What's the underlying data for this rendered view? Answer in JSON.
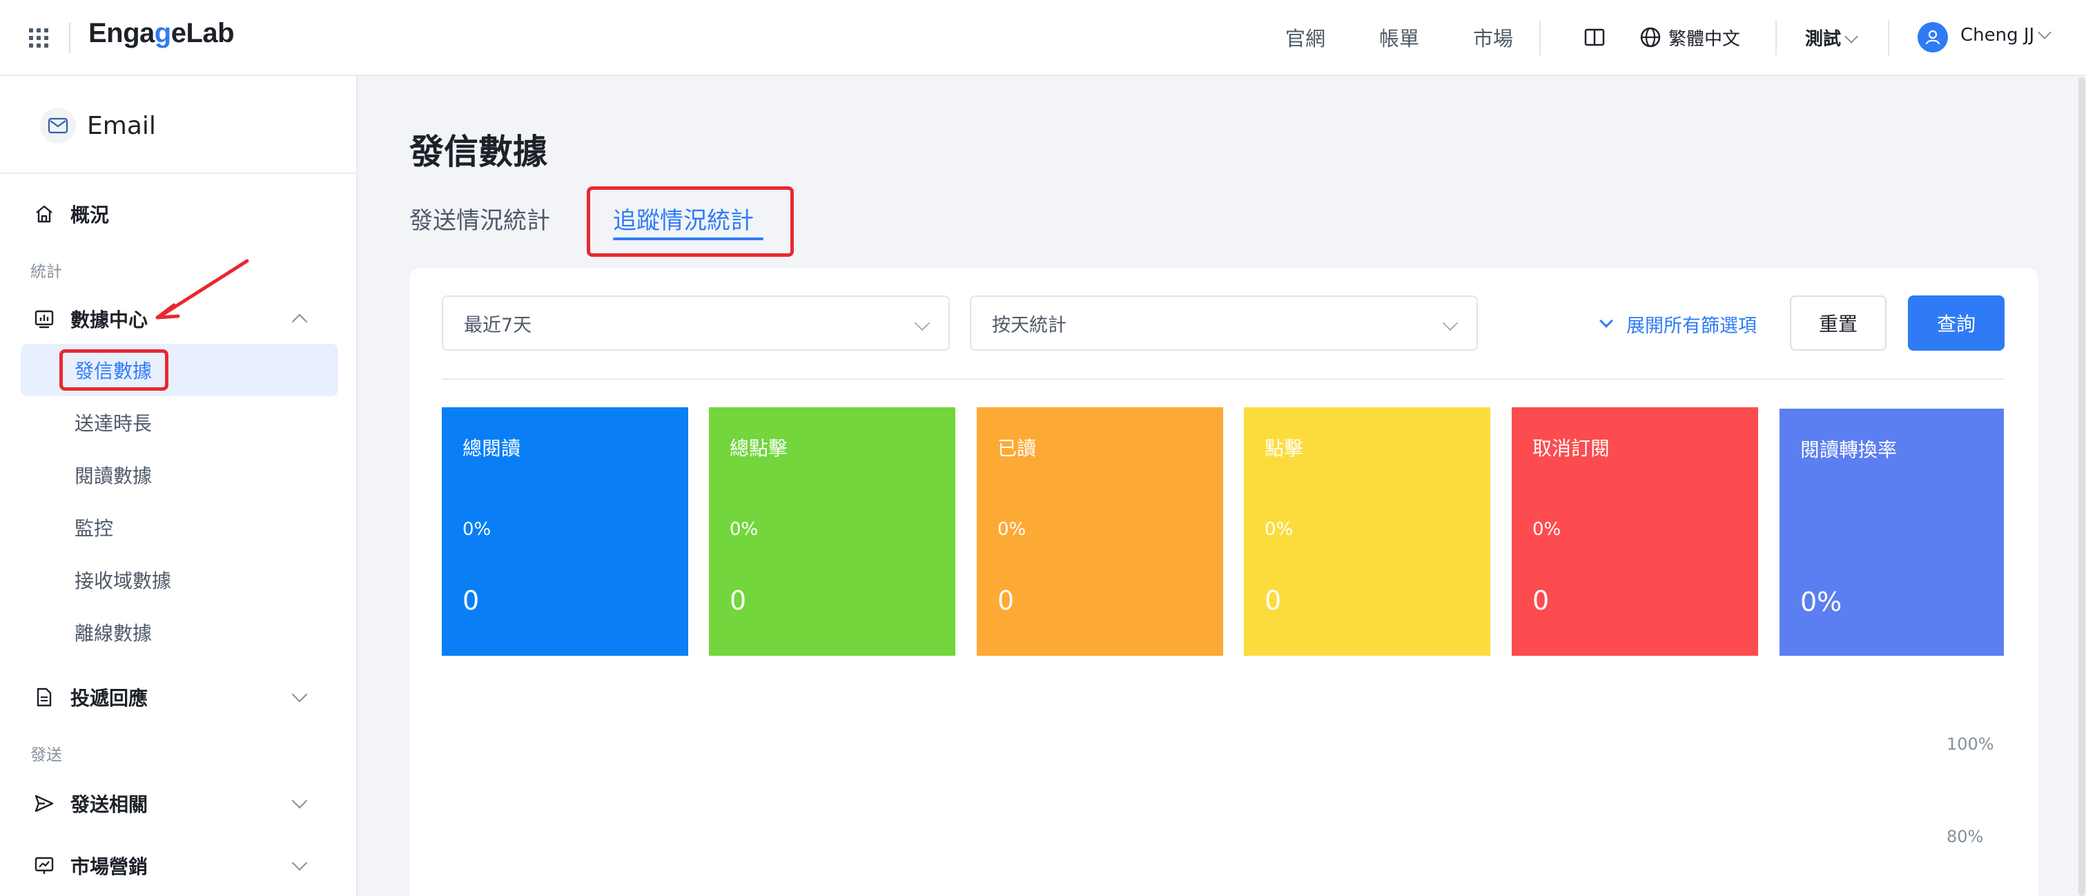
{
  "header": {
    "logo_pre": "Enga",
    "logo_accent": "g",
    "logo_post": "eLab",
    "nav": [
      "官網",
      "帳單",
      "市場"
    ],
    "language": "繁體中文",
    "project": "測試",
    "user": "Cheng JJ"
  },
  "sidebar": {
    "product": "Email",
    "overview": "概況",
    "group_stats": "統計",
    "data_center": "數據中心",
    "data_center_items": [
      "發信數據",
      "送達時長",
      "閱讀數據",
      "監控",
      "接收域數據",
      "離線數據"
    ],
    "delivery_response": "投遞回應",
    "group_send": "發送",
    "send_related": "發送相關",
    "marketing": "市場營銷"
  },
  "main": {
    "title": "發信數據",
    "tabs": [
      "發送情況統計",
      "追蹤情況統計"
    ],
    "filters": {
      "date_range": "最近7天",
      "granularity": "按天統計",
      "expand_all": "展開所有篩選項",
      "reset": "重置",
      "query": "查詢"
    },
    "stats": [
      {
        "label": "總閱讀",
        "percent": "0%",
        "value": "0",
        "color": "#0a7ff5"
      },
      {
        "label": "總點擊",
        "percent": "0%",
        "value": "0",
        "color": "#72d63c"
      },
      {
        "label": "已讀",
        "percent": "0%",
        "value": "0",
        "color": "#fda935"
      },
      {
        "label": "點擊",
        "percent": "0%",
        "value": "0",
        "color": "#fcdc3c"
      },
      {
        "label": "取消訂閱",
        "percent": "0%",
        "value": "0",
        "color": "#fd4c4f"
      },
      {
        "label": "閱讀轉換率",
        "percent": "",
        "value": "0%",
        "color": "#5b7ff0"
      }
    ],
    "chart_axis": [
      "100%",
      "80%"
    ]
  },
  "colors": {
    "accent": "#2f7bf6",
    "annotation": "#e8292f"
  }
}
